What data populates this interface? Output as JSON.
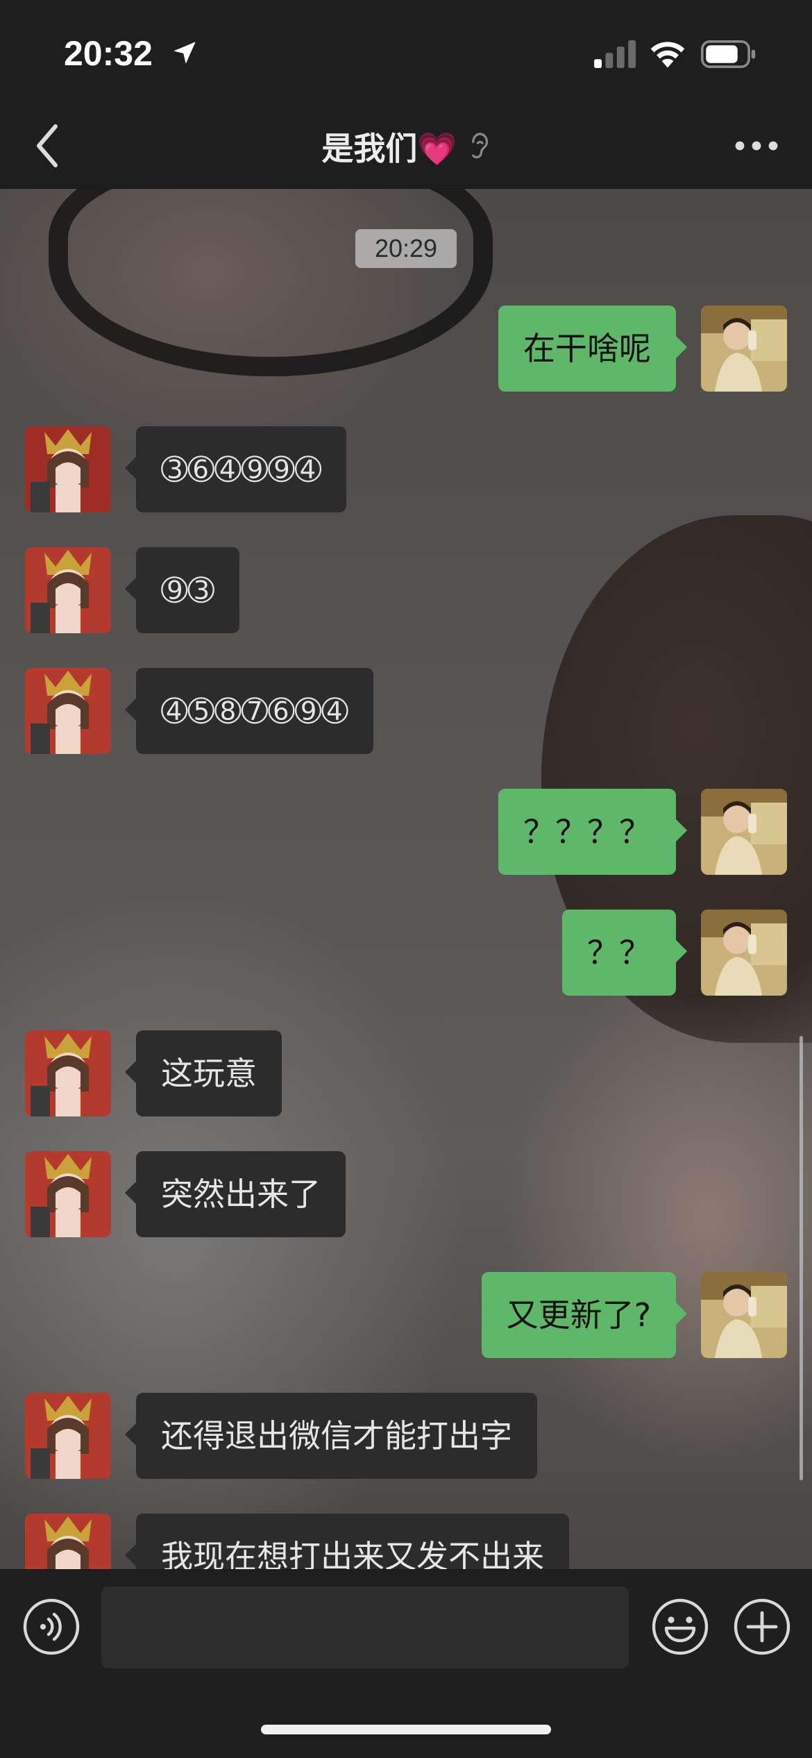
{
  "status_bar": {
    "time": "20:32"
  },
  "nav": {
    "title": "是我们💗"
  },
  "chat": {
    "timestamp": "20:29",
    "messages": [
      {
        "side": "right",
        "text": "在干啥呢"
      },
      {
        "side": "left",
        "text": "➂➅➃➈➈➃"
      },
      {
        "side": "left",
        "text": "➈➂"
      },
      {
        "side": "left",
        "text": "➃➄➇➆➅➈➃"
      },
      {
        "side": "right",
        "text": "？？？？"
      },
      {
        "side": "right",
        "text": "？？"
      },
      {
        "side": "left",
        "text": "这玩意"
      },
      {
        "side": "left",
        "text": "突然出来了"
      },
      {
        "side": "right",
        "text": "又更新了?"
      },
      {
        "side": "left",
        "text": "还得退出微信才能打出字"
      },
      {
        "side": "left",
        "text": "我现在想打出来又发不出来"
      }
    ]
  },
  "input": {
    "value": ""
  },
  "colors": {
    "sent_bubble": "#5fb86a",
    "received_bubble": "#2c2c2c",
    "bar_background": "#1e1e1e"
  },
  "icons": {
    "back": "chevron-left-icon",
    "more": "more-dots-icon",
    "voice": "voice-icon",
    "emoji": "emoji-icon",
    "plus": "plus-icon",
    "ear": "ear-icon",
    "heart": "heart-icon"
  }
}
